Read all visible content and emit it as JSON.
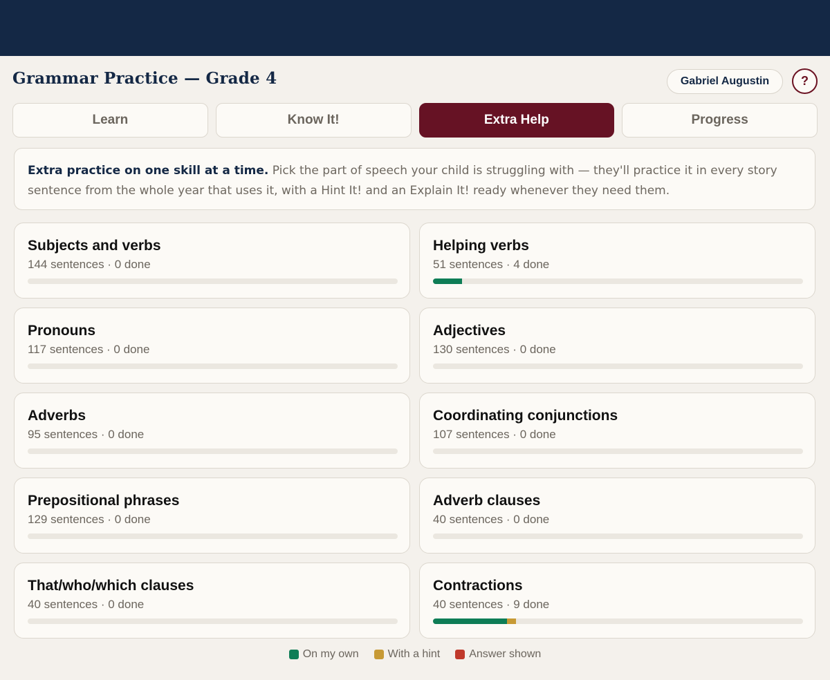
{
  "app": {
    "title": "Grammar Practice — Grade 4",
    "user_name": "Gabriel Augustin",
    "help_label": "?"
  },
  "tabs": [
    {
      "label": "Learn",
      "active": false
    },
    {
      "label": "Know It!",
      "active": false
    },
    {
      "label": "Extra Help",
      "active": true
    },
    {
      "label": "Progress",
      "active": false
    }
  ],
  "intro": {
    "lead": "Extra practice on one skill at a time.",
    "body": " Pick the part of speech your child is struggling with — they'll practice it in every story sentence from the whole year that uses it, with a Hint It! and an Explain It! ready whenever they need them."
  },
  "colors": {
    "own": "#0e7d56",
    "hint": "#c79a35",
    "shown": "#c0392b",
    "accent": "#661224",
    "navy": "#142845"
  },
  "skills": [
    {
      "title": "Subjects and verbs",
      "meta": "144 sentences · 0 done",
      "own": 0,
      "hint": 0,
      "shown": 0
    },
    {
      "title": "Helping verbs",
      "meta": "51 sentences · 4 done",
      "own": 0.078,
      "hint": 0,
      "shown": 0
    },
    {
      "title": "Pronouns",
      "meta": "117 sentences · 0 done",
      "own": 0,
      "hint": 0,
      "shown": 0
    },
    {
      "title": "Adjectives",
      "meta": "130 sentences · 0 done",
      "own": 0,
      "hint": 0,
      "shown": 0
    },
    {
      "title": "Adverbs",
      "meta": "95 sentences · 0 done",
      "own": 0,
      "hint": 0,
      "shown": 0
    },
    {
      "title": "Coordinating conjunctions",
      "meta": "107 sentences · 0 done",
      "own": 0,
      "hint": 0,
      "shown": 0
    },
    {
      "title": "Prepositional phrases",
      "meta": "129 sentences · 0 done",
      "own": 0,
      "hint": 0,
      "shown": 0
    },
    {
      "title": "Adverb clauses",
      "meta": "40 sentences · 0 done",
      "own": 0,
      "hint": 0,
      "shown": 0
    },
    {
      "title": "That/who/which clauses",
      "meta": "40 sentences · 0 done",
      "own": 0,
      "hint": 0,
      "shown": 0
    },
    {
      "title": "Contractions",
      "meta": "40 sentences · 9 done",
      "own": 0.2,
      "hint": 0.025,
      "shown": 0
    }
  ],
  "legend": [
    {
      "label": "On my own",
      "color": "#0e7d56"
    },
    {
      "label": "With a hint",
      "color": "#c79a35"
    },
    {
      "label": "Answer shown",
      "color": "#c0392b"
    }
  ]
}
